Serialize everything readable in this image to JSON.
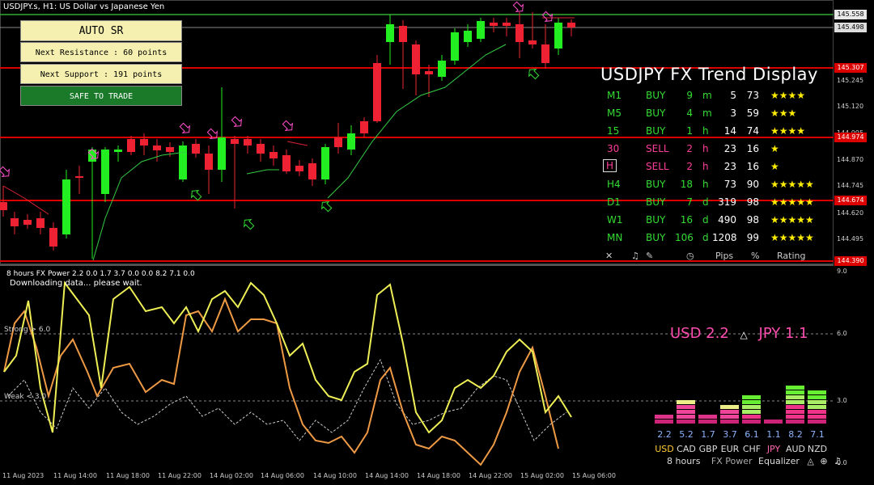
{
  "window": {
    "title": "USDJPY.s, H1:  US Dollar vs Japanese Yen"
  },
  "sr_panel": {
    "mode_label": "AUTO SR",
    "next_resistance": "Next Resistance : 60 points",
    "next_support": "Next Support : 191 points",
    "status": "SAFE TO TRADE"
  },
  "trend_display": {
    "title": "USDJPY FX Trend Display",
    "rows": [
      {
        "tf": "M1",
        "signal": "BUY",
        "dur_n": "9",
        "dur_u": "m",
        "pips": "5",
        "pct": "73",
        "stars": "★★★★",
        "color": "#33dd33"
      },
      {
        "tf": "M5",
        "signal": "BUY",
        "dur_n": "4",
        "dur_u": "m",
        "pips": "3",
        "pct": "59",
        "stars": "★★★",
        "color": "#33dd33"
      },
      {
        "tf": "15",
        "signal": "BUY",
        "dur_n": "1",
        "dur_u": "h",
        "pips": "14",
        "pct": "74",
        "stars": "★★★★",
        "color": "#33dd33"
      },
      {
        "tf": "30",
        "signal": "SELL",
        "dur_n": "2",
        "dur_u": "h",
        "pips": "23",
        "pct": "16",
        "stars": "★",
        "color": "#ff3d9a"
      },
      {
        "tf": "H",
        "signal": "SELL",
        "dur_n": "2",
        "dur_u": "h",
        "pips": "23",
        "pct": "16",
        "stars": "★",
        "color": "#ff3d9a"
      },
      {
        "tf": "H4",
        "signal": "BUY",
        "dur_n": "18",
        "dur_u": "h",
        "pips": "73",
        "pct": "90",
        "stars": "★★★★★",
        "color": "#33dd33"
      },
      {
        "tf": "D1",
        "signal": "BUY",
        "dur_n": "7",
        "dur_u": "d",
        "pips": "319",
        "pct": "98",
        "stars": "★★★★★",
        "color": "#33dd33"
      },
      {
        "tf": "W1",
        "signal": "BUY",
        "dur_n": "16",
        "dur_u": "d",
        "pips": "490",
        "pct": "98",
        "stars": "★★★★★",
        "color": "#33dd33"
      },
      {
        "tf": "MN",
        "signal": "BUY",
        "dur_n": "106",
        "dur_u": "d",
        "pips": "1208",
        "pct": "99",
        "stars": "★★★★★",
        "color": "#33dd33"
      }
    ],
    "footer": {
      "pips_label": "Pips",
      "pct_label": "%",
      "rating_label": "Rating"
    }
  },
  "price_axis": {
    "labels": [
      "145.558",
      "145.498",
      "145.307",
      "145.245",
      "145.120",
      "144.995",
      "144.974",
      "144.870",
      "144.745",
      "144.674",
      "144.620",
      "144.495",
      "144.390"
    ],
    "highlighted": [
      {
        "value": "145.558",
        "bg": "#e8e8e8",
        "fg": "#000"
      },
      {
        "value": "145.498",
        "bg": "#dddddd",
        "fg": "#000"
      },
      {
        "value": "145.307",
        "bg": "#dd0000",
        "fg": "#fff"
      },
      {
        "value": "144.974",
        "bg": "#dd0000",
        "fg": "#fff"
      },
      {
        "value": "144.674",
        "bg": "#dd0000",
        "fg": "#fff"
      },
      {
        "value": "144.390",
        "bg": "#dd0000",
        "fg": "#fff"
      }
    ]
  },
  "time_axis": [
    "11 Aug 2023",
    "11 Aug 14:00",
    "11 Aug 18:00",
    "11 Aug 22:00",
    "14 Aug 02:00",
    "14 Aug 06:00",
    "14 Aug 10:00",
    "14 Aug 14:00",
    "14 Aug 18:00",
    "14 Aug 22:00",
    "15 Aug 02:00",
    "15 Aug 06:00"
  ],
  "indicator": {
    "title": "8 hours FX Power 2.2 0.0 1.7 3.7 0.0 0.0 8.2 7.1 0.0",
    "status": "Downloading data... please wait.",
    "strong_label": "Strong > 6.0",
    "weak_label": "Weak < 3.0",
    "y_labels": [
      "9.0",
      "6.0",
      "3.0",
      "0.0"
    ],
    "strength_base": "USD 2.2",
    "strength_sep": "△",
    "strength_quote": "JPY 1.1",
    "equalizer": [
      {
        "cur": "USD",
        "value": "2.2",
        "level": 2.2,
        "cur_color": "#ffcc33"
      },
      {
        "cur": "CAD",
        "value": "5.2",
        "level": 5.2,
        "cur_color": "#dddddd"
      },
      {
        "cur": "GBP",
        "value": "1.7",
        "level": 1.7,
        "cur_color": "#dddddd"
      },
      {
        "cur": "EUR",
        "value": "3.7",
        "level": 3.7,
        "cur_color": "#dddddd"
      },
      {
        "cur": "CHF",
        "value": "6.1",
        "level": 6.1,
        "cur_color": "#dddddd"
      },
      {
        "cur": "JPY",
        "value": "1.1",
        "level": 1.1,
        "cur_color": "#ff66b0"
      },
      {
        "cur": "AUD",
        "value": "8.2",
        "level": 8.2,
        "cur_color": "#dddddd"
      },
      {
        "cur": "NZD",
        "value": "7.1",
        "level": 7.1,
        "cur_color": "#dddddd"
      }
    ],
    "footer": {
      "period": "8 hours",
      "name": "FX Power",
      "mode": "Equalizer"
    }
  },
  "colors": {
    "bull": "#22ee22",
    "bear": "#ee2233",
    "resistance": "#dd0000",
    "support_top": "#33aa33",
    "signal_ma": "#33cc44"
  }
}
